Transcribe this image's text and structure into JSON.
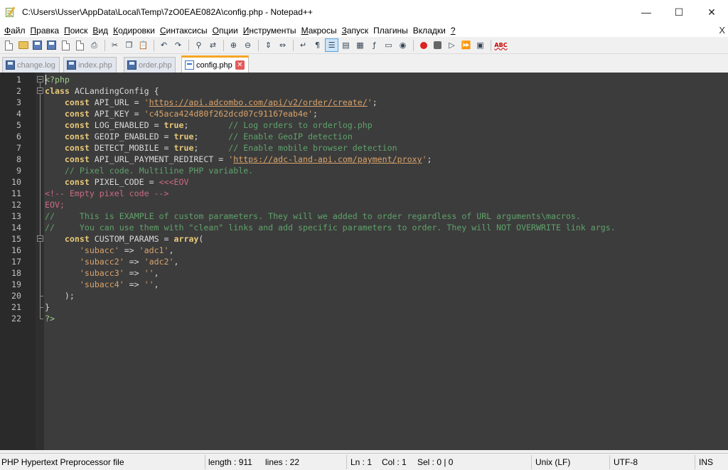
{
  "window": {
    "title": "C:\\Users\\Usser\\AppData\\Local\\Temp\\7zO0EAE082A\\config.php - Notepad++",
    "minimize": "—",
    "maximize": "☐",
    "close": "✕"
  },
  "menu": {
    "items": [
      {
        "pre": "",
        "ul": "Ф",
        "post": "айл"
      },
      {
        "pre": "",
        "ul": "П",
        "post": "равка"
      },
      {
        "pre": "",
        "ul": "П",
        "post": "оиск"
      },
      {
        "pre": "",
        "ul": "В",
        "post": "ид"
      },
      {
        "pre": "",
        "ul": "К",
        "post": "одировки"
      },
      {
        "pre": "",
        "ul": "С",
        "post": "интаксисы"
      },
      {
        "pre": "",
        "ul": "О",
        "post": "пции"
      },
      {
        "pre": "",
        "ul": "И",
        "post": "нструменты"
      },
      {
        "pre": "",
        "ul": "М",
        "post": "акросы"
      },
      {
        "pre": "",
        "ul": "З",
        "post": "апуск"
      },
      {
        "pre": "",
        "ul": "",
        "post": "Плагины"
      },
      {
        "pre": "",
        "ul": "",
        "post": "Вкладки"
      },
      {
        "pre": "",
        "ul": "?",
        "post": ""
      }
    ],
    "close": "X"
  },
  "tabs": [
    {
      "label": "change.log",
      "active": false
    },
    {
      "label": "index.php",
      "active": false
    },
    {
      "label": "order.php",
      "active": false
    },
    {
      "label": "config.php",
      "active": true
    }
  ],
  "editor": {
    "lines": [
      [
        [
          "php",
          "<?php"
        ]
      ],
      [
        [
          "k",
          "class"
        ],
        [
          "txt",
          " ACLandingConfig {"
        ]
      ],
      [
        [
          "txt",
          "    "
        ],
        [
          "k",
          "const"
        ],
        [
          "txt",
          " API_URL = "
        ],
        [
          "str",
          "'"
        ],
        [
          "url",
          "https://api.adcombo.com/api/v2/order/create/"
        ],
        [
          "str",
          "'"
        ],
        [
          "txt",
          ";"
        ]
      ],
      [
        [
          "txt",
          "    "
        ],
        [
          "k",
          "const"
        ],
        [
          "txt",
          " API_KEY = "
        ],
        [
          "str",
          "'c45aca424d80f262dcd07c91167eab4e'"
        ],
        [
          "txt",
          ";"
        ]
      ],
      [
        [
          "txt",
          "    "
        ],
        [
          "k",
          "const"
        ],
        [
          "txt",
          " LOG_ENABLED = "
        ],
        [
          "k",
          "true"
        ],
        [
          "txt",
          ";        "
        ],
        [
          "cm",
          "// Log orders to orderlog.php"
        ]
      ],
      [
        [
          "txt",
          "    "
        ],
        [
          "k",
          "const"
        ],
        [
          "txt",
          " GEOIP_ENABLED = "
        ],
        [
          "k",
          "true"
        ],
        [
          "txt",
          ";      "
        ],
        [
          "cm",
          "// Enable GeoIP detection"
        ]
      ],
      [
        [
          "txt",
          "    "
        ],
        [
          "k",
          "const"
        ],
        [
          "txt",
          " DETECT_MOBILE = "
        ],
        [
          "k",
          "true"
        ],
        [
          "txt",
          ";      "
        ],
        [
          "cm",
          "// Enable mobile browser detection"
        ]
      ],
      [
        [
          "txt",
          "    "
        ],
        [
          "k",
          "const"
        ],
        [
          "txt",
          " API_URL_PAYMENT_REDIRECT = "
        ],
        [
          "str",
          "'"
        ],
        [
          "url",
          "https://adc-land-api.com/payment/proxy"
        ],
        [
          "str",
          "'"
        ],
        [
          "txt",
          ";"
        ]
      ],
      [
        [
          "txt",
          "    "
        ],
        [
          "cm",
          "// Pixel code. Multiline PHP variable."
        ]
      ],
      [
        [
          "txt",
          "    "
        ],
        [
          "k",
          "const"
        ],
        [
          "txt",
          " PIXEL_CODE = "
        ],
        [
          "heredoc",
          "<<<EOV"
        ]
      ],
      [
        [
          "html",
          "<!-- Empty pixel code -->"
        ]
      ],
      [
        [
          "heredoc",
          "EOV;"
        ]
      ],
      [
        [
          "cm",
          "//     This is EXAMPLE of custom parameters. They will we added to order regardless of URL arguments\\macros."
        ]
      ],
      [
        [
          "cm",
          "//     You can use them with \"clean\" links and add specific parameters to order. They will NOT OVERWRITE link args."
        ]
      ],
      [
        [
          "txt",
          "    "
        ],
        [
          "k",
          "const"
        ],
        [
          "txt",
          " CUSTOM_PARAMS = "
        ],
        [
          "k",
          "array"
        ],
        [
          "txt",
          "("
        ]
      ],
      [
        [
          "txt",
          "       "
        ],
        [
          "str",
          "'subacc'"
        ],
        [
          "txt",
          " => "
        ],
        [
          "str",
          "'adc1'"
        ],
        [
          "txt",
          ","
        ]
      ],
      [
        [
          "txt",
          "       "
        ],
        [
          "str",
          "'subacc2'"
        ],
        [
          "txt",
          " => "
        ],
        [
          "str",
          "'adc2'"
        ],
        [
          "txt",
          ","
        ]
      ],
      [
        [
          "txt",
          "       "
        ],
        [
          "str",
          "'subacc3'"
        ],
        [
          "txt",
          " => "
        ],
        [
          "str",
          "''"
        ],
        [
          "txt",
          ","
        ]
      ],
      [
        [
          "txt",
          "       "
        ],
        [
          "str",
          "'subacc4'"
        ],
        [
          "txt",
          " => "
        ],
        [
          "str",
          "''"
        ],
        [
          "txt",
          ","
        ]
      ],
      [
        [
          "txt",
          "    );"
        ]
      ],
      [
        [
          "txt",
          "}"
        ]
      ],
      [
        [
          "php",
          "?>"
        ]
      ]
    ]
  },
  "status": {
    "language": "PHP Hypertext Preprocessor file",
    "length": "length : 911",
    "lines": "lines : 22",
    "ln": "Ln : 1",
    "col": "Col : 1",
    "sel": "Sel : 0 | 0",
    "eol": "Unix (LF)",
    "encoding": "UTF-8",
    "mode": "INS"
  },
  "toolbar": {
    "icons": [
      "new-file-icon",
      "open-file-icon",
      "save-icon",
      "save-all-icon",
      "close-icon",
      "close-all-icon",
      "print-icon",
      "cut-icon",
      "copy-icon",
      "paste-icon",
      "undo-icon",
      "redo-icon",
      "find-icon",
      "replace-icon",
      "zoom-in-icon",
      "zoom-out-icon",
      "sync-v-icon",
      "sync-h-icon",
      "word-wrap-icon",
      "show-all-chars-icon",
      "indent-guide-icon",
      "udl-icon",
      "doc-map-icon",
      "function-list-icon",
      "folder-workspace-icon",
      "monitoring-icon",
      "record-macro-icon",
      "stop-macro-icon",
      "play-macro-icon",
      "run-macro-multiple-icon",
      "save-macro-icon",
      "spellcheck-icon"
    ],
    "spellcheck_label": "ABC"
  }
}
